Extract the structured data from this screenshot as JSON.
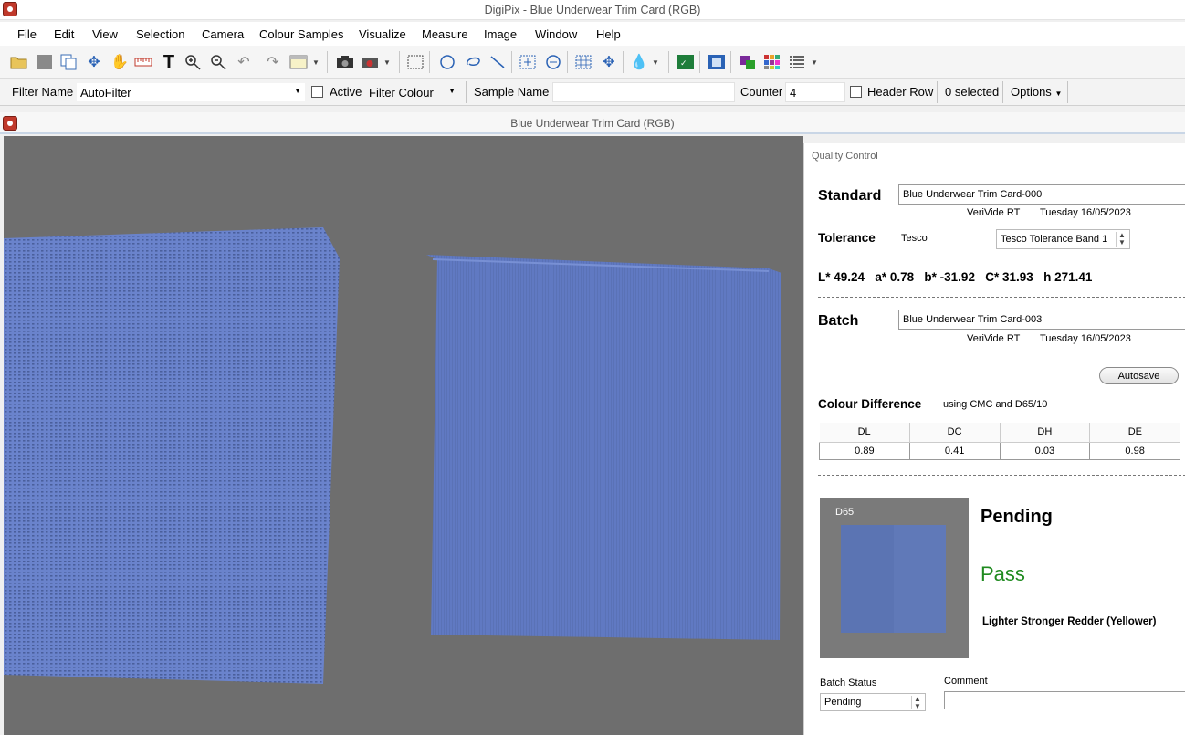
{
  "app": {
    "title": "DigiPix - Blue Underwear Trim Card (RGB)"
  },
  "menu": [
    "File",
    "Edit",
    "View",
    "Selection",
    "Camera",
    "Colour Samples",
    "Visualize",
    "Measure",
    "Image",
    "Window",
    "Help"
  ],
  "filterbar": {
    "filter_name_label": "Filter Name",
    "filter_name_value": "AutoFilter",
    "active_label": "Active",
    "filter_colour_label": "Filter Colour",
    "sample_name_label": "Sample Name",
    "sample_name_value": "",
    "counter_label": "Counter",
    "counter_value": "4",
    "header_row_label": "Header Row",
    "selected_text": "0 selected",
    "options_label": "Options"
  },
  "document": {
    "title": "Blue Underwear Trim Card (RGB)"
  },
  "qc": {
    "panel_title": "Quality Control",
    "standard": {
      "label": "Standard",
      "name": "Blue Underwear Trim Card-000",
      "device": "VeriVide RT",
      "date": "Tuesday 16/05/2023"
    },
    "tolerance": {
      "label": "Tolerance",
      "source": "Tesco",
      "band": "Tesco Tolerance Band 1"
    },
    "lab": {
      "L_label": "L*",
      "L": "49.24",
      "a_label": "a*",
      "a": "0.78",
      "b_label": "b*",
      "b": "-31.92",
      "C_label": "C*",
      "C": "31.93",
      "h_label": "h",
      "h": "271.41"
    },
    "batch": {
      "label": "Batch",
      "name": "Blue Underwear Trim Card-003",
      "device": "VeriVide RT",
      "date": "Tuesday 16/05/2023"
    },
    "autosave_label": "Autosave",
    "colour_difference": {
      "label": "Colour Difference",
      "method": "using CMC and D65/10",
      "headers": [
        "DL",
        "DC",
        "DH",
        "DE"
      ],
      "values": [
        "0.89",
        "0.41",
        "0.03",
        "0.98"
      ]
    },
    "swatch": {
      "illuminant": "D65",
      "standard_color": "#5b74b3",
      "batch_color": "#6079b8",
      "bg_color": "#7a7a7a"
    },
    "status_primary": "Pending",
    "result": "Pass",
    "result_color": "#1f8a1f",
    "description": "Lighter Stronger Redder (Yellower)",
    "batch_status_label": "Batch Status",
    "batch_status_value": "Pending",
    "comment_label": "Comment",
    "comment_value": ""
  },
  "icons": [
    "open-folder-icon",
    "save-icon",
    "copy-icon",
    "move-icon",
    "hand-icon",
    "ruler-icon",
    "text-icon",
    "zoom-in-icon",
    "zoom-out-icon",
    "undo-icon",
    "redo-icon",
    "window-icon",
    "camera-icon",
    "camera-settings-icon",
    "rect-select-icon",
    "ellipse-select-icon",
    "lasso-icon",
    "line-icon",
    "fit-icon",
    "rotate-icon",
    "grid-icon",
    "pan-icon",
    "dropper-icon",
    "excel-icon",
    "report-icon",
    "palette-icon",
    "swatch-grid-icon",
    "list-icon"
  ],
  "fabric": {
    "color": "#6079c2",
    "bg": "#6e6e6e"
  }
}
